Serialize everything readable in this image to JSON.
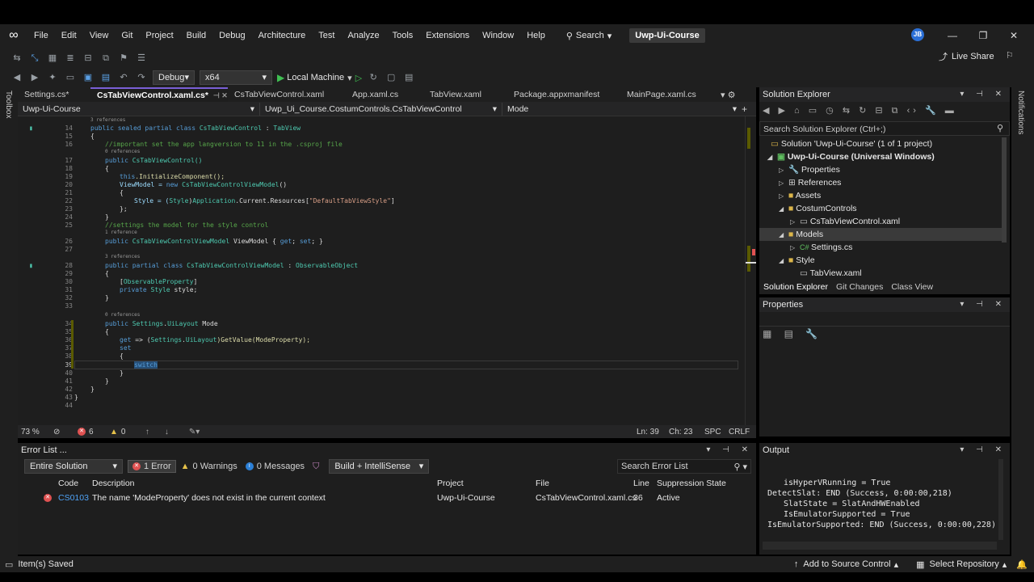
{
  "menu": {
    "items": [
      "File",
      "Edit",
      "View",
      "Git",
      "Project",
      "Build",
      "Debug",
      "Architecture",
      "Test",
      "Analyze",
      "Tools",
      "Extensions",
      "Window",
      "Help"
    ],
    "search_label": "Search",
    "project_title": "Uwp-Ui-Course",
    "avatar_initials": "JB"
  },
  "toolbar": {
    "config": "Debug",
    "platform": "x64",
    "run_target": "Local Machine",
    "live_share": "Live Share"
  },
  "tabs": [
    {
      "label": "Settings.cs*"
    },
    {
      "label": "CsTabViewControl.xaml.cs*"
    },
    {
      "label": "CsTabViewControl.xaml"
    },
    {
      "label": "App.xaml.cs"
    },
    {
      "label": "TabView.xaml"
    },
    {
      "label": "Package.appxmanifest"
    },
    {
      "label": "MainPage.xaml.cs"
    }
  ],
  "navbar": {
    "project": "Uwp-Ui-Course",
    "type": "Uwp_Ui_Course.CostumControls.CsTabViewControl",
    "member": "Mode"
  },
  "side": {
    "toolbox": "Toolbox",
    "notifications": "Notifications"
  },
  "editor": {
    "refs": {
      "r3": "3 references",
      "r0a": "0 references",
      "r1": "1 reference",
      "r3b": "3 references",
      "r0b": "0 references"
    },
    "lines": {
      "n14": "14",
      "n15": "15",
      "n16": "16",
      "n17": "17",
      "n18": "18",
      "n19": "19",
      "n20": "20",
      "n21": "21",
      "n22": "22",
      "n23": "23",
      "n24": "24",
      "n25": "25",
      "n26": "26",
      "n27": "27",
      "n28": "28",
      "n29": "29",
      "n30": "30",
      "n31": "31",
      "n32": "32",
      "n33": "33",
      "n34": "34",
      "n35": "35",
      "n36": "36",
      "n37": "37",
      "n38": "38",
      "n39": "39",
      "n40": "40",
      "n41": "41",
      "n42": "42",
      "n43": "43",
      "n44": "44"
    },
    "code": {
      "l14_kw": "public sealed partial class ",
      "l14_ty": "CsTabViewControl",
      "l14_p": " : ",
      "l14_base": "TabView",
      "l15": "{",
      "l16": "//important set the app langversion to 11 in the .csproj file",
      "l17_kw": "public ",
      "l17_rest": "CsTabViewControl()",
      "l18": "{",
      "l19_kw": "this",
      "l19_rest": ".InitializeComponent();",
      "l20_a": "ViewModel = ",
      "l20_kw": "new ",
      "l20_ty": "CsTabViewControlViewModel",
      "l20_b": "()",
      "l21": "{",
      "l22_a": "Style = (",
      "l22_ty": "Style",
      "l22_b": ")",
      "l22_ty2": "Application",
      "l22_c": ".Current.Resources[",
      "l22_st": "\"DefaultTabViewStyle\"",
      "l22_d": "]",
      "l23": "};",
      "l24": "}",
      "l25": "//settings the model for the style control",
      "l26_kw": "public ",
      "l26_ty": "CsTabViewControlViewModel",
      "l26_a": " ViewModel { ",
      "l26_kw2": "get",
      "l26_b": "; ",
      "l26_kw3": "set",
      "l26_c": "; }",
      "l28_kw": "public partial class ",
      "l28_ty": "CsTabViewControlViewModel",
      "l28_a": " : ",
      "l28_ty2": "ObservableObject",
      "l29": "{",
      "l30_a": "[",
      "l30_ty": "ObservableProperty",
      "l30_b": "]",
      "l31_kw": "private ",
      "l31_ty": "Style",
      "l31_a": " style;",
      "l32": "}",
      "l34_kw": "public ",
      "l34_ty": "Settings",
      "l34_a": ".",
      "l34_ty2": "UiLayout",
      "l34_b": " Mode",
      "l35": "{",
      "l36_kw": "get",
      "l36_a": " => (",
      "l36_ty": "Settings",
      "l36_b": ".",
      "l36_ty2": "UiLayout",
      "l36_c": ")GetValue(ModeProperty);",
      "l37_kw": "set",
      "l38": "{",
      "l39_kw": "switch",
      "l40": "}",
      "l41": "}",
      "l42": "}",
      "l43": "}"
    }
  },
  "editor_status": {
    "zoom": "73 %",
    "errors": "6",
    "warnings": "0",
    "line": "Ln: 39",
    "col": "Ch: 23",
    "spc": "SPC",
    "eol": "CRLF"
  },
  "solution_explorer": {
    "title": "Solution Explorer",
    "search_placeholder": "Search Solution Explorer (Ctrl+;)",
    "items": [
      {
        "label": "Solution 'Uwp-Ui-Course' (1 of 1 project)"
      },
      {
        "label": "Uwp-Ui-Course (Universal Windows)"
      },
      {
        "label": "Properties"
      },
      {
        "label": "References"
      },
      {
        "label": "Assets"
      },
      {
        "label": "CostumControls"
      },
      {
        "label": "CsTabViewControl.xaml"
      },
      {
        "label": "Models"
      },
      {
        "label": "Settings.cs"
      },
      {
        "label": "Style"
      },
      {
        "label": "TabView.xaml"
      }
    ],
    "tabs": [
      "Solution Explorer",
      "Git Changes",
      "Class View"
    ]
  },
  "properties": {
    "title": "Properties"
  },
  "error_list": {
    "title": "Error List ...",
    "scope": "Entire Solution",
    "errors_btn": "1 Error",
    "warnings_btn": "0 Warnings",
    "messages_btn": "0 Messages",
    "build_filter": "Build + IntelliSense",
    "search_placeholder": "Search Error List",
    "columns": [
      "Code",
      "Description",
      "Project",
      "File",
      "Line",
      "Suppression State"
    ],
    "rows": [
      {
        "code": "CS0103",
        "description": "The name 'ModeProperty' does not exist in the current context",
        "project": "Uwp-Ui-Course",
        "file": "CsTabViewControl.xaml.cs",
        "line": "36",
        "state": "Active"
      }
    ]
  },
  "output": {
    "title": "Output",
    "lines": [
      "isHyperVRunning = True",
      "DetectSlat: END (Success, 0:00:00,218)",
      "SlatState = SlatAndHWEnabled",
      "IsEmulatorSupported = True",
      "IsEmulatorSupported: END (Success, 0:00:00,228)"
    ]
  },
  "statusbar": {
    "saved": "Item(s) Saved",
    "source_control": "Add to Source Control",
    "repository": "Select Repository"
  }
}
